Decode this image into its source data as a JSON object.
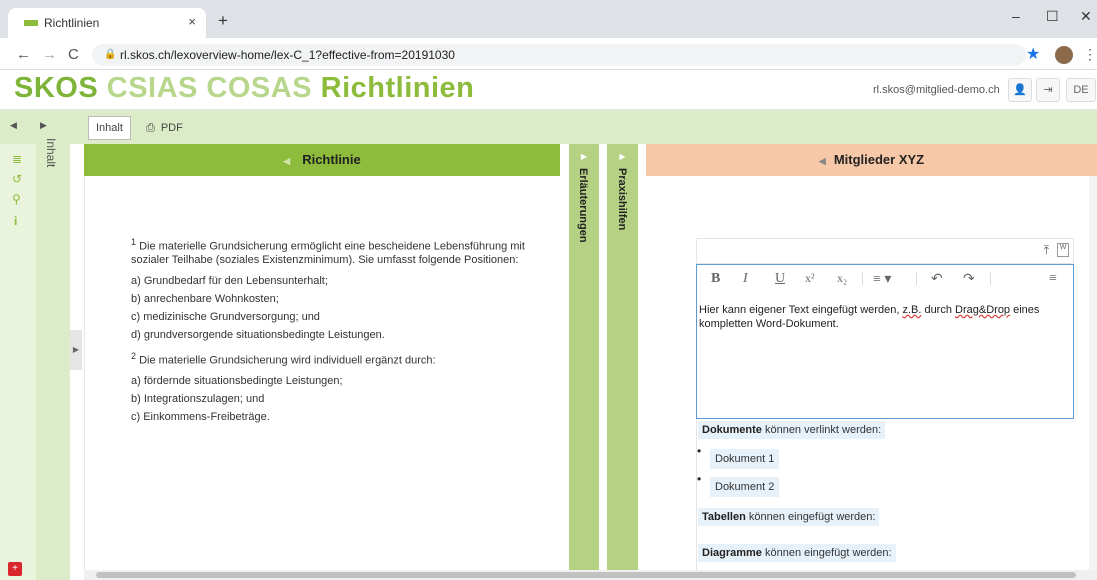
{
  "browser": {
    "tab_title": "Richtlinien",
    "tab_close": "×",
    "new_tab": "+",
    "url": "rl.skos.ch/lexoverview-home/lex-C_1?effective-from=20191030",
    "minimize": "–",
    "maximize": "☐",
    "close": "✕"
  },
  "header": {
    "logo_part1": "SKOS",
    "logo_part2": "CSIAS COSAS",
    "logo_part3": "Richtlinien",
    "email": "rl.skos@mitglied-demo.ch",
    "lang": "DE"
  },
  "toolbar": {
    "inhalt_label": "Inhalt",
    "pdf_label": "PDF"
  },
  "sidebar": {
    "inhalt_label": "Inhalt"
  },
  "richtlinie": {
    "title": "Richtlinie",
    "para1_num": "1",
    "para1_text": " Die materielle Grundsicherung ermöglicht eine bescheidene Lebensführung mit sozialer Teilhabe (soziales Existenzminimum). Sie umfasst folgende Positionen:",
    "list1": [
      "a)  Grundbedarf für den Lebensunterhalt;",
      "b)  anrechenbare Wohnkosten;",
      "c)  medizinische Grundversorgung; und",
      "d)  grundversorgende situationsbedingte Leistungen."
    ],
    "para2_num": "2",
    "para2_text": " Die materielle Grundsicherung wird individuell ergänzt durch:",
    "list2": [
      "a)  fördernde situationsbedingte Leistungen;",
      "b)  Integrationszulagen; und",
      "c)  Einkommens-Freibeträge."
    ]
  },
  "strips": {
    "erlaeuterungen": "Erläuterungen",
    "praxishilfen": "Praxishilfen"
  },
  "mitglieder": {
    "title": "Mitglieder XYZ",
    "editor_tools": {
      "bold": "B",
      "italic": "I",
      "underline": "U",
      "superscript": "x²",
      "subscript": "x₂"
    },
    "editor_text_1": "Hier kann eigener Text eingefügt werden, ",
    "editor_text_zb": "z.B.",
    "editor_text_2": " durch ",
    "editor_text_dd": "Drag&Drop",
    "editor_text_3": " eines kompletten Word-Dokument.",
    "dokumente_bold": "Dokumente",
    "dokumente_rest": " können verlinkt werden:",
    "doc1": "Dokument 1",
    "doc2": "Dokument 2",
    "tabellen_bold": "Tabellen",
    "tabellen_rest": " können eingefügt werden:",
    "diagramme_bold": "Diagramme",
    "diagramme_rest": " können eingefügt werden:"
  },
  "colors": {
    "brand_green": "#8dbb3b",
    "strip_green": "#b4d184",
    "peach": "#f6c8a8",
    "light_green": "#dcebc8"
  }
}
